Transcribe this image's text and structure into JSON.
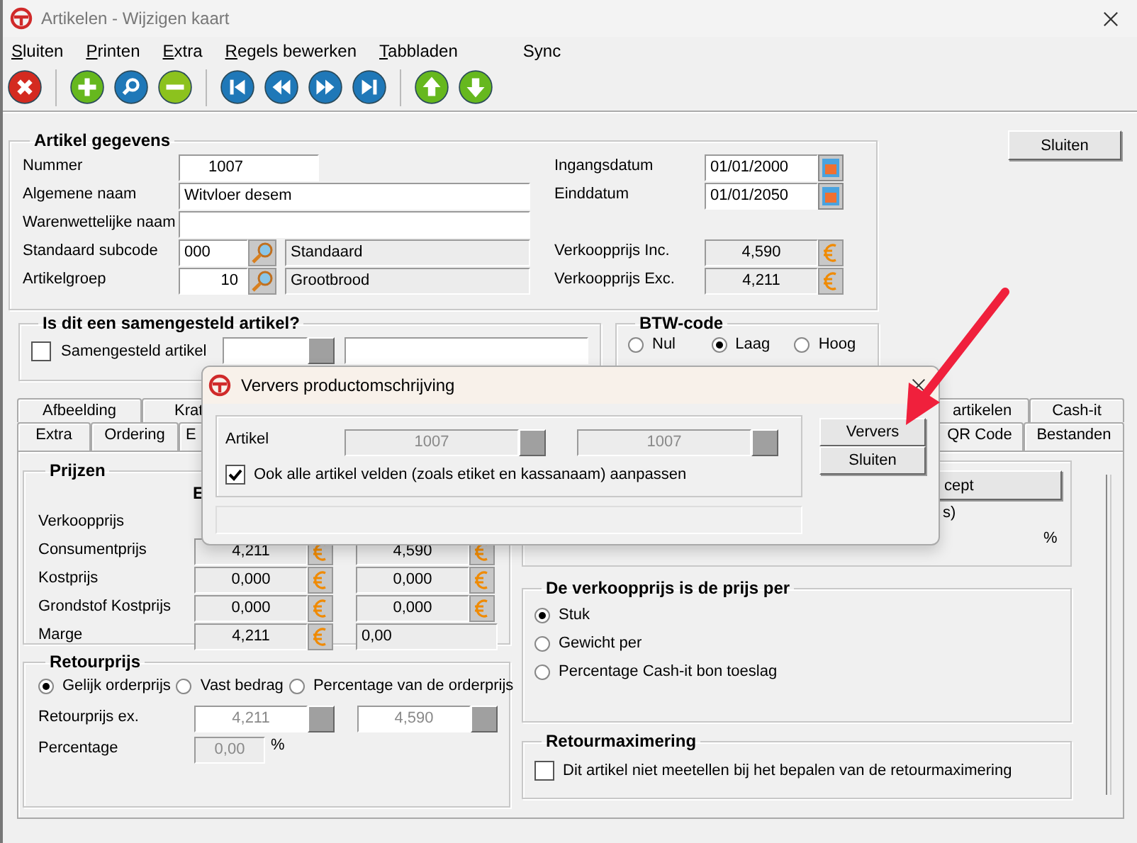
{
  "window": {
    "title": "Artikelen - Wijzigen kaart"
  },
  "menu": [
    {
      "label": "Sluiten",
      "underline": true
    },
    {
      "label": "Printen",
      "underline": true
    },
    {
      "label": "Extra",
      "underline": true
    },
    {
      "label": "Regels bewerken",
      "underline": true
    },
    {
      "label": "Tabbladen",
      "underline": true
    },
    {
      "label": "Sync",
      "underline": false
    }
  ],
  "toolbar": [
    [
      {
        "kind": "delete"
      }
    ],
    [
      {
        "kind": "add"
      },
      {
        "kind": "search"
      },
      {
        "kind": "remove"
      }
    ],
    [
      {
        "kind": "first"
      },
      {
        "kind": "previous"
      },
      {
        "kind": "next"
      },
      {
        "kind": "last"
      }
    ],
    [
      {
        "kind": "up"
      },
      {
        "kind": "down"
      }
    ]
  ],
  "close_button": "Sluiten",
  "artikel": {
    "title": "Artikel gegevens",
    "nummer": {
      "label": "Nummer",
      "value": "1007"
    },
    "algemene_naam": {
      "label": "Algemene naam",
      "value": "Witvloer desem"
    },
    "warenwettelijke_naam": {
      "label": "Warenwettelijke naam"
    },
    "subcode": {
      "label": "Standaard subcode",
      "code": "000",
      "name": "Standaard"
    },
    "artikelgroep": {
      "label": "Artikelgroep",
      "code": "10",
      "name": "Grootbrood"
    },
    "ingangsdatum": {
      "label": "Ingangsdatum",
      "value": "01/01/2000"
    },
    "einddatum": {
      "label": "Einddatum",
      "value": "01/01/2050"
    },
    "verkoopprijs_inc": {
      "label": "Verkoopprijs Inc.",
      "value": "4,590"
    },
    "verkoopprijs_exc": {
      "label": "Verkoopprijs Exc.",
      "value": "4,211"
    }
  },
  "samengesteld": {
    "title": "Is dit een samengesteld artikel?",
    "label": "Samengesteld artikel",
    "checked": false
  },
  "btw": {
    "title": "BTW-code",
    "options": [
      {
        "label": "Nul",
        "selected": false
      },
      {
        "label": "Laag",
        "selected": true
      },
      {
        "label": "Hoog",
        "selected": false
      }
    ]
  },
  "tabs": {
    "row_1": {
      "left": [
        {
          "label": "Afbeelding"
        },
        {
          "label": "Krat"
        }
      ],
      "right": [
        {
          "label": "artikelen"
        },
        {
          "label": "Cash-it"
        }
      ]
    },
    "row_2": {
      "left": [
        {
          "label": "Extra"
        },
        {
          "label": "Ordering"
        },
        {
          "label": "E"
        }
      ],
      "right": [
        {
          "label": "QR Code"
        },
        {
          "label": "Bestanden"
        }
      ]
    }
  },
  "prijzen": {
    "title": "Prijzen",
    "column_heading": "E",
    "rows": [
      {
        "label": "Verkoopprijs",
        "kind": "label"
      },
      {
        "label": "Consumentprijs",
        "kind": "price",
        "exc": "4,211",
        "inc": "4,590"
      },
      {
        "label": "Kostprijs",
        "kind": "price",
        "exc": "0,000",
        "inc": "0,000"
      },
      {
        "label": "Grondstof Kostprijs",
        "kind": "price",
        "exc": "0,000",
        "inc": "0,000"
      },
      {
        "label": "Marge",
        "kind": "margin",
        "exc": "4,211",
        "inc": "0,00"
      }
    ]
  },
  "retourprijs": {
    "title": "Retourprijs",
    "options": [
      {
        "label": "Gelijk orderprijs",
        "selected": true
      },
      {
        "label": "Vast bedrag",
        "selected": false
      },
      {
        "label": "Percentage van de orderprijs",
        "selected": false
      }
    ],
    "retourprijs_ex": {
      "label": "Retourprijs ex.",
      "exc": "4,211",
      "inc": "4,590"
    },
    "percentage": {
      "label": "Percentage",
      "value": "0,00",
      "unit": "%"
    }
  },
  "recept": {
    "button": "cept",
    "note": "s)",
    "unit": "%"
  },
  "prijs_per": {
    "title": "De verkoopprijs is de prijs per",
    "options": [
      {
        "label": "Stuk",
        "selected": true
      },
      {
        "label": "Gewicht per",
        "selected": false
      },
      {
        "label": "Percentage Cash-it bon toeslag",
        "selected": false
      }
    ]
  },
  "retourmaximering": {
    "title": "Retourmaximering",
    "label": "Dit artikel niet meetellen bij het bepalen van de retourmaximering",
    "checked": false
  },
  "dialog": {
    "title": "Ververs productomschrijving",
    "artikel_label": "Artikel",
    "artikel_from": "1007",
    "artikel_to": "1007",
    "checkbox": {
      "label": "Ook alle artikel velden (zoals etiket en kassanaam) aanpassen",
      "checked": true
    },
    "buttons": [
      "Ververs",
      "Sluiten"
    ]
  }
}
